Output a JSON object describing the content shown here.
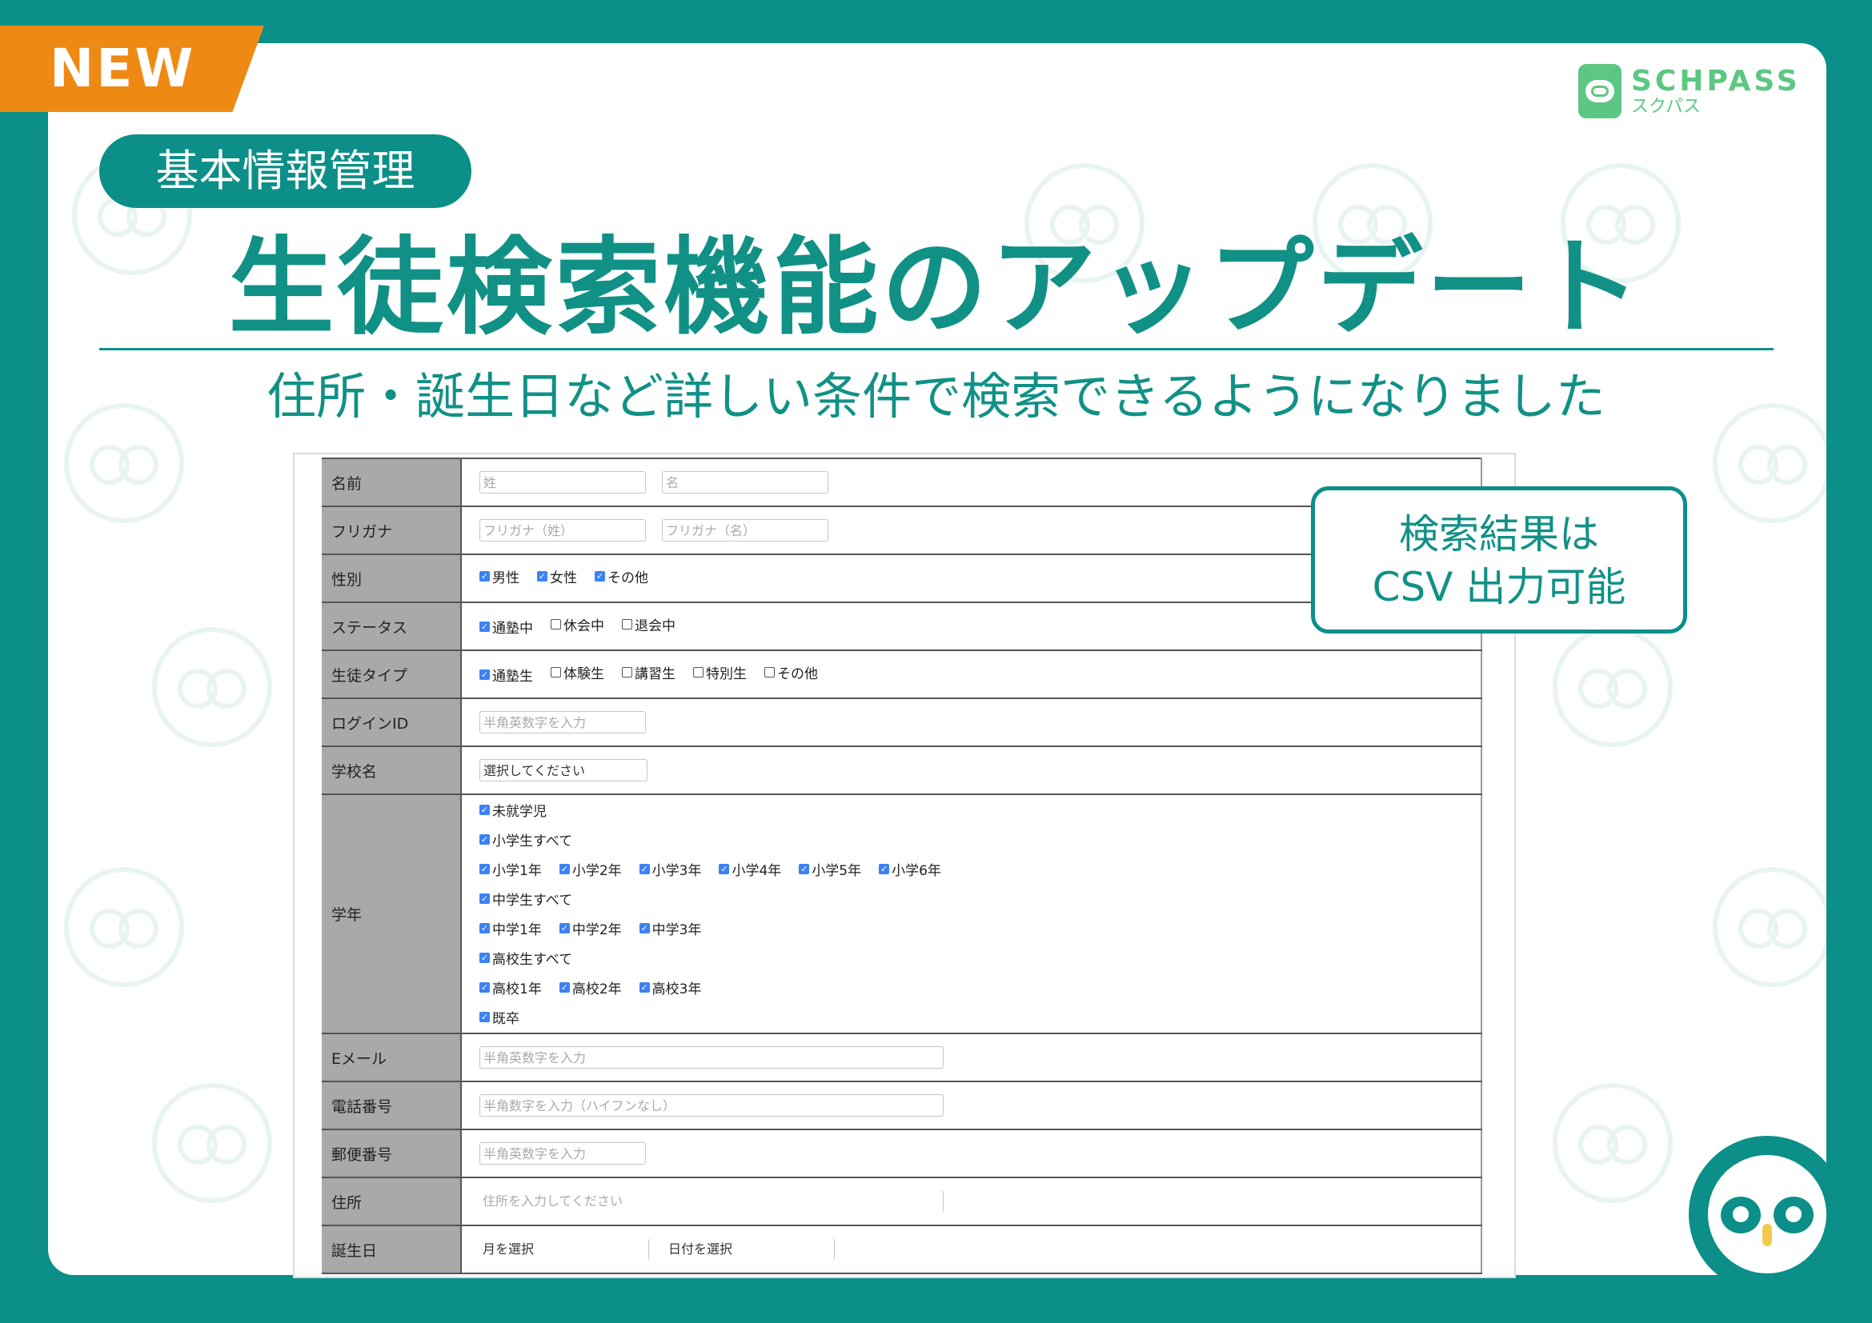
{
  "badge": "NEW",
  "logo": {
    "main": "SCHPASS",
    "sub": "スクパス"
  },
  "category": "基本情報管理",
  "title": "生徒検索機能のアップデート",
  "subtitle": "住所・誕生日など詳しい条件で検索できるようになりました",
  "callout": {
    "line1": "検索結果は",
    "line2": "CSV 出力可能"
  },
  "colors": {
    "teal": "#0b8f88",
    "orange": "#ee8a14",
    "logo_green": "#5cc783",
    "checkbox_blue": "#3b82f6"
  },
  "form": {
    "name": {
      "label": "名前",
      "last_placeholder": "姓",
      "first_placeholder": "名"
    },
    "kana": {
      "label": "フリガナ",
      "last_placeholder": "フリガナ（姓）",
      "first_placeholder": "フリガナ（名）"
    },
    "gender": {
      "label": "性別",
      "options": [
        "男性",
        "女性",
        "その他"
      ]
    },
    "status": {
      "label": "ステータス",
      "options": [
        "通塾中",
        "休会中",
        "退会中"
      ]
    },
    "type": {
      "label": "生徒タイプ",
      "options": [
        "通塾生",
        "体験生",
        "講習生",
        "特別生",
        "その他"
      ]
    },
    "login": {
      "label": "ログインID",
      "placeholder": "半角英数字を入力"
    },
    "school": {
      "label": "学校名",
      "value": "選択してください"
    },
    "grade": {
      "label": "学年",
      "preschool": "未就学児",
      "elem_all": "小学生すべて",
      "elem": [
        "小学1年",
        "小学2年",
        "小学3年",
        "小学4年",
        "小学5年",
        "小学6年"
      ],
      "jh_all": "中学生すべて",
      "jh": [
        "中学1年",
        "中学2年",
        "中学3年"
      ],
      "hs_all": "高校生すべて",
      "hs": [
        "高校1年",
        "高校2年",
        "高校3年"
      ],
      "grad": "既卒"
    },
    "email": {
      "label": "Eメール",
      "placeholder": "半角英数字を入力"
    },
    "phone": {
      "label": "電話番号",
      "placeholder": "半角数字を入力（ハイフンなし）"
    },
    "zip": {
      "label": "郵便番号",
      "placeholder": "半角英数字を入力"
    },
    "address": {
      "label": "住所",
      "placeholder": "住所を入力してください"
    },
    "birthday": {
      "label": "誕生日",
      "month": "月を選択",
      "day": "日付を選択"
    }
  }
}
